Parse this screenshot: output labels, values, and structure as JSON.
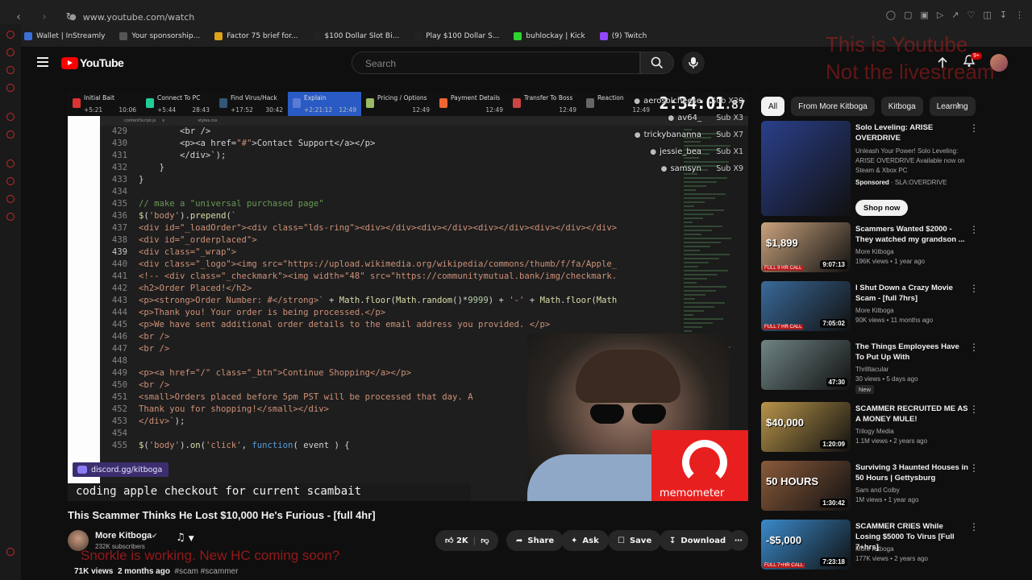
{
  "browser": {
    "url": "www.youtube.com/watch",
    "bookmarks": [
      {
        "label": "Wallet | InStreamly",
        "color": "#3a6fd8"
      },
      {
        "label": "Your sponsorship...",
        "color": "#555555"
      },
      {
        "label": "Factor 75 brief for...",
        "color": "#e0a21a"
      },
      {
        "label": "$100 Dollar Slot Bi...",
        "color": "#222222"
      },
      {
        "label": "Play $100 Dollar S...",
        "color": "#222222"
      },
      {
        "label": "buhlockay | Kick",
        "color": "#2fd32f"
      },
      {
        "label": "(9) Twitch",
        "color": "#9146ff"
      }
    ]
  },
  "header": {
    "logo_text": "YouTube",
    "search_placeholder": "Search",
    "notif_count": "9+",
    "overlay_note_line1": "This is Youtube",
    "overlay_note_line2": "Not the livestream"
  },
  "stream": {
    "segments": [
      {
        "label": "Initial Bait",
        "time_left": "+5:21",
        "time_right": "10:06",
        "color": "#d33"
      },
      {
        "label": "Connect To PC",
        "time_left": "+5:44",
        "time_right": "28:43",
        "color": "#2c9"
      },
      {
        "label": "Find Virus/Hack",
        "time_left": "+17:52",
        "time_right": "30:42",
        "color": "#357"
      },
      {
        "label": "Explain",
        "time_left": "+2:21:12",
        "time_right": "12:49",
        "color": "#5a7bd4"
      },
      {
        "label": "Pricing / Options",
        "time_left": "",
        "time_right": "12:49",
        "color": "#9b6"
      },
      {
        "label": "Payment Details",
        "time_left": "",
        "time_right": "12:49",
        "color": "#e63"
      },
      {
        "label": "Transfer To Boss",
        "time_left": "",
        "time_right": "12:49",
        "color": "#c44"
      },
      {
        "label": "Reaction",
        "time_left": "",
        "time_right": "12:49",
        "color": "#666"
      }
    ],
    "timer_main": "2:34:01",
    "timer_frac": ".87",
    "chat": [
      {
        "name": "aerosolcheese",
        "sub": "Sub X29"
      },
      {
        "name": "av64_",
        "sub": "Sub X3"
      },
      {
        "name": "trickybananna",
        "sub": "Sub X7"
      },
      {
        "name": "jessie_bea",
        "sub": "Sub X1"
      },
      {
        "name": "samsyn",
        "sub": "Sub X9"
      }
    ],
    "discord_label": "discord.gg/kitboga",
    "caption": "coding apple checkout for current scambait",
    "memometer_label": "memometer"
  },
  "code_lines": [
    {
      "n": "429",
      "html": "        <span class='tag'>&lt;br /&gt;</span>"
    },
    {
      "n": "430",
      "html": "        <span class='tag'>&lt;p&gt;&lt;a href=</span><span class='str'>\"#\"</span><span class='tag'>&gt;Contact Support&lt;/a&gt;&lt;/p&gt;</span>"
    },
    {
      "n": "431",
      "html": "        <span class='tag'>&lt;/div&gt;`);</span>"
    },
    {
      "n": "432",
      "html": "    }"
    },
    {
      "n": "433",
      "html": "}"
    },
    {
      "n": "434",
      "html": ""
    },
    {
      "n": "435",
      "html": "<span class='cm'>// make a \"universal purchased page\"</span>"
    },
    {
      "n": "436",
      "html": "<span class='fn'>$</span>(<span class='str'>'body'</span>).<span class='fn'>prepend</span>(<span class='str'>`</span>"
    },
    {
      "n": "437",
      "html": "<span class='str'>&lt;div id=\"_loadOrder\"&gt;&lt;div class=\"lds-ring\"&gt;&lt;div&gt;&lt;/div&gt;&lt;div&gt;&lt;/div&gt;&lt;div&gt;&lt;/div&gt;&lt;div&gt;&lt;/div&gt;&lt;/div&gt;</span>"
    },
    {
      "n": "438",
      "html": "<span class='str'>&lt;div id=\"_orderplaced\"&gt;</span>"
    },
    {
      "n": "439",
      "html": "<span class='str'>&lt;div class=\"_wrap\"&gt;</span>"
    },
    {
      "n": "440",
      "html": "<span class='str'>&lt;div class=\"_logo\"&gt;&lt;img src=\"https://upload.wikimedia.org/wikipedia/commons/thumb/f/fa/Apple_</span>"
    },
    {
      "n": "441",
      "html": "<span class='str'>&lt;!-- &lt;div class=\"_checkmark\"&gt;&lt;img width=\"48\" src=\"https://communitymutual.bank/img/checkmark.</span>"
    },
    {
      "n": "442",
      "html": "<span class='str'>&lt;h2&gt;Order Placed!&lt;/h2&gt;</span>"
    },
    {
      "n": "443",
      "html": "<span class='str'>&lt;p&gt;&lt;strong&gt;Order Number: #&lt;/strong&gt;`</span> + <span class='fn'>Math</span>.<span class='fn'>floor</span>(<span class='fn'>Math</span>.<span class='fn'>random</span>()*<span class='num'>9999</span>) + <span class='str'>'-'</span> + <span class='fn'>Math</span>.<span class='fn'>floor</span>(<span class='fn'>Math</span>"
    },
    {
      "n": "444",
      "html": "<span class='str'>&lt;p&gt;Thank you! Your order is being processed.&lt;/p&gt;</span>"
    },
    {
      "n": "445",
      "html": "<span class='str'>&lt;p&gt;We have sent additional order details to the email address you provided. &lt;/p&gt;</span>"
    },
    {
      "n": "446",
      "html": "<span class='str'>&lt;br /&gt;</span>"
    },
    {
      "n": "447",
      "html": "<span class='str'>&lt;br /&gt;</span>"
    },
    {
      "n": "448",
      "html": ""
    },
    {
      "n": "449",
      "html": "<span class='str'>&lt;p&gt;&lt;a href=\"/\" class=\"_btn\"&gt;Continue Shopping&lt;/a&gt;&lt;/p&gt;</span>"
    },
    {
      "n": "450",
      "html": "<span class='str'>&lt;br /&gt;</span>"
    },
    {
      "n": "451",
      "html": "<span class='str'>&lt;small&gt;Orders placed before 5pm PST will be processed that day. A</span>"
    },
    {
      "n": "452",
      "html": "<span class='str'>Thank you for shopping!&lt;/small&gt;&lt;/div&gt;</span>"
    },
    {
      "n": "453",
      "html": "<span class='str'>&lt;/div&gt;`</span>);"
    },
    {
      "n": "454",
      "html": ""
    },
    {
      "n": "455",
      "html": "<span class='fn'>$</span>(<span class='str'>'body'</span>).<span class='fn'>on</span>(<span class='str'>'click'</span>, <span class='kw'>function</span>( event ) {"
    }
  ],
  "video": {
    "title": "This Scammer Thinks He Lost $10,000 He's Furious - [full 4hr]",
    "channel": "More Kitboga",
    "subscribers": "232K subscribers",
    "likes": "2K",
    "share": "Share",
    "ask": "Ask",
    "save": "Save",
    "download": "Download",
    "views": "71K views",
    "age": "2 months ago",
    "tags": "#scam #scammer",
    "red_overlay": "Snorkle is working. New HC coming soon?"
  },
  "chips": [
    "All",
    "From More Kitboga",
    "Kitboga",
    "Learning"
  ],
  "recommendations": [
    {
      "title": "Solo Leveling: ARISE OVERDRIVE",
      "desc": "Unleash Your Power! Solo Leveling: ARISE OVERDRIVE Available now on Steam & Xbox PC",
      "sponsored": "Sponsored",
      "sponsor_name": "SLA:OVERDRIVE",
      "shop": "Shop now",
      "thumb_bg": "#2a3f8a"
    },
    {
      "title": "Scammers Wanted $2000 - They watched my grandson ...",
      "channel": "More Kitboga",
      "meta": "196K views • 1 year ago",
      "duration": "9:07:13",
      "thumb_bg": "#c9a27d",
      "big": "$1,899",
      "corner": "FULL 9 HR CALL"
    },
    {
      "title": "I Shut Down a Crazy Movie Scam - [full 7hrs]",
      "channel": "More Kitboga",
      "meta": "90K views • 11 months ago",
      "duration": "7:05:02",
      "thumb_bg": "#3a6a9a",
      "big": "",
      "corner": "FULL 7 HR CALL"
    },
    {
      "title": "The Things Employees Have To Put Up With",
      "channel": "Thrilltacular",
      "meta": "30 views • 5 days ago",
      "duration": "47:30",
      "thumb_bg": "#6f8484",
      "big": "",
      "corner": "",
      "new": "New"
    },
    {
      "title": "SCAMMER RECRUITED ME AS A MONEY MULE!",
      "channel": "Trilogy Media",
      "meta": "1.1M views • 2 years ago",
      "duration": "1:20:09",
      "thumb_bg": "#b8944a",
      "big": "$40,000",
      "corner": ""
    },
    {
      "title": "Surviving 3 Haunted Houses in 50 Hours | Gettysburg",
      "channel": "Sam and Colby",
      "meta": "1M views • 1 year ago",
      "duration": "1:30:42",
      "thumb_bg": "#8a5a3a",
      "big": "50 HOURS",
      "corner": ""
    },
    {
      "title": "SCAMMER CRIES While Losing $5000 To Virus [Full 7+hrs]",
      "channel": "More Kitboga",
      "meta": "177K views • 2 years ago",
      "duration": "7:23:18",
      "thumb_bg": "#3a8acb",
      "big": "-$5,000",
      "corner": "FULL 7+HR CALL"
    }
  ]
}
